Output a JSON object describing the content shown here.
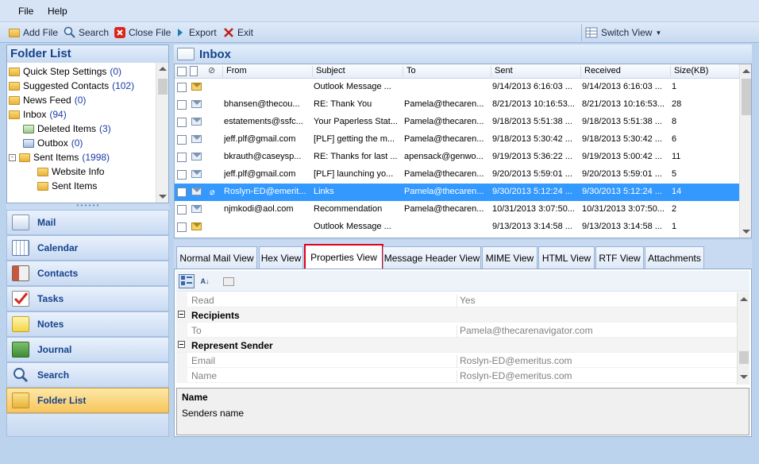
{
  "menu": {
    "file": "File",
    "help": "Help"
  },
  "toolbar": {
    "add_file": "Add File",
    "search": "Search",
    "close_file": "Close File",
    "export": "Export",
    "exit": "Exit",
    "switch_view": "Switch View"
  },
  "folder_list": {
    "title": "Folder List",
    "items": [
      {
        "label": "Quick Step Settings",
        "count": "(0)"
      },
      {
        "label": "Suggested Contacts",
        "count": "(102)"
      },
      {
        "label": "News Feed",
        "count": "(0)"
      },
      {
        "label": "Inbox",
        "count": "(94)"
      },
      {
        "label": "Deleted Items",
        "count": "(3)"
      },
      {
        "label": "Outbox",
        "count": "(0)"
      },
      {
        "label": "Sent Items",
        "count": "(1998)"
      },
      {
        "label": "Website Info",
        "count": ""
      },
      {
        "label": "Sent Items",
        "count": ""
      }
    ]
  },
  "nav": {
    "mail": "Mail",
    "calendar": "Calendar",
    "contacts": "Contacts",
    "tasks": "Tasks",
    "notes": "Notes",
    "journal": "Journal",
    "search": "Search",
    "folder_list": "Folder List"
  },
  "inbox": {
    "title": "Inbox",
    "columns": {
      "from": "From",
      "subject": "Subject",
      "to": "To",
      "sent": "Sent",
      "received": "Received",
      "size": "Size(KB)"
    },
    "rows": [
      {
        "from": "",
        "subject": "Outlook Message ...",
        "to": "",
        "sent": "9/14/2013 6:16:03 ...",
        "received": "9/14/2013 6:16:03 ...",
        "size": "1"
      },
      {
        "from": "bhansen@thecou...",
        "subject": "RE: Thank You",
        "to": "Pamela@thecaren...",
        "sent": "8/21/2013 10:16:53...",
        "received": "8/21/2013 10:16:53...",
        "size": "28"
      },
      {
        "from": "estatements@ssfc...",
        "subject": "Your Paperless Stat...",
        "to": "Pamela@thecaren...",
        "sent": "9/18/2013 5:51:38 ...",
        "received": "9/18/2013 5:51:38 ...",
        "size": "8"
      },
      {
        "from": "jeff.plf@gmail.com",
        "subject": "[PLF] getting the m...",
        "to": "Pamela@thecaren...",
        "sent": "9/18/2013 5:30:42 ...",
        "received": "9/18/2013 5:30:42 ...",
        "size": "6"
      },
      {
        "from": "bkrauth@caseysp...",
        "subject": "RE: Thanks for last ...",
        "to": "apensack@genwo...",
        "sent": "9/19/2013 5:36:22 ...",
        "received": "9/19/2013 5:00:42 ...",
        "size": "11"
      },
      {
        "from": "jeff.plf@gmail.com",
        "subject": "[PLF] launching yo...",
        "to": "Pamela@thecaren...",
        "sent": "9/20/2013 5:59:01 ...",
        "received": "9/20/2013 5:59:01 ...",
        "size": "5"
      },
      {
        "from": "Roslyn-ED@emerit...",
        "subject": "Links",
        "to": "Pamela@thecaren...",
        "sent": "9/30/2013 5:12:24 ...",
        "received": "9/30/2013 5:12:24 ...",
        "size": "14"
      },
      {
        "from": "njmkodi@aol.com",
        "subject": "Recommendation",
        "to": "Pamela@thecaren...",
        "sent": "10/31/2013 3:07:50...",
        "received": "10/31/2013 3:07:50...",
        "size": "2"
      },
      {
        "from": "",
        "subject": "Outlook Message ...",
        "to": "",
        "sent": "9/13/2013 3:14:58 ...",
        "received": "9/13/2013 3:14:58 ...",
        "size": "1"
      }
    ]
  },
  "tabs": [
    "Normal Mail View",
    "Hex View",
    "Properties View",
    "Message Header View",
    "MIME View",
    "HTML View",
    "RTF View",
    "Attachments"
  ],
  "properties": {
    "rows": [
      {
        "name": "Read",
        "value": "Yes"
      },
      {
        "category": "Recipients"
      },
      {
        "name": "To",
        "value": "Pamela@thecarenavigator.com"
      },
      {
        "category": "Represent Sender"
      },
      {
        "name": "Email",
        "value": "Roslyn-ED@emeritus.com"
      },
      {
        "name": "Name",
        "value": "Roslyn-ED@emeritus.com"
      }
    ],
    "description_title": "Name",
    "description_text": "Senders name"
  },
  "colors": {
    "accent": "#15428b",
    "selection": "#3399ff",
    "active_tab_border": "#e0001b"
  }
}
